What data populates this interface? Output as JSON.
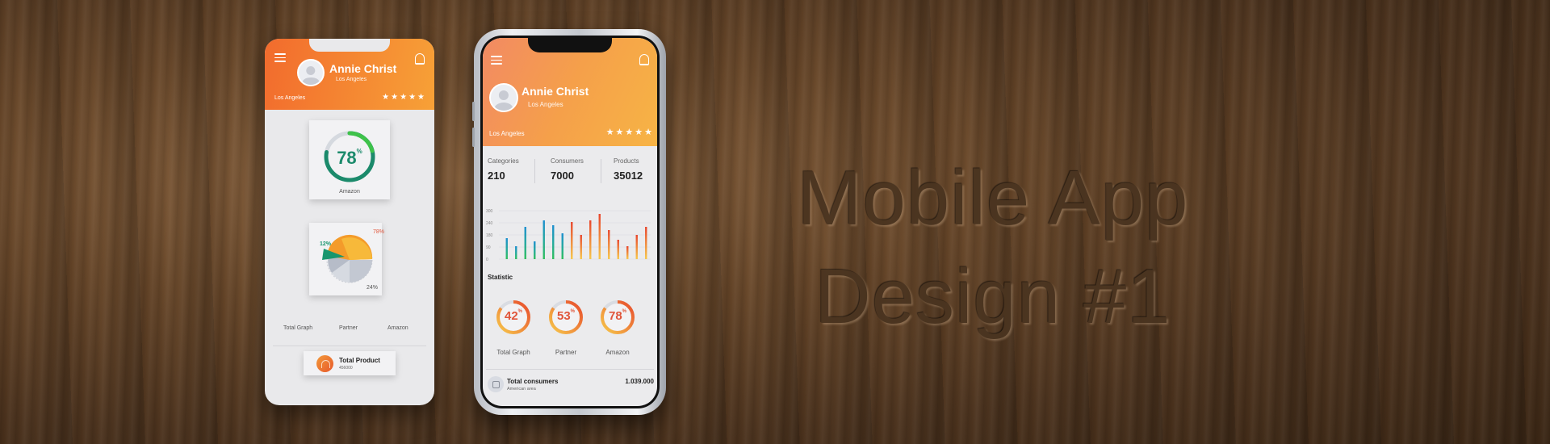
{
  "headline": {
    "line1": "Mobile App",
    "line2": "Design #1"
  },
  "phone1": {
    "user_name": "Annie Christ",
    "city": "Los Angeles",
    "location": "Los Angeles",
    "stars": "★★★★★",
    "gauge_value": "78",
    "gauge_unit": "%",
    "gauge_label": "Amazon",
    "pie_labels": {
      "a": "12%",
      "b": "78%",
      "c": "24%"
    },
    "legend": [
      "Total Graph",
      "Partner",
      "Amazon"
    ],
    "product_title": "Total Product",
    "product_sub": "456000"
  },
  "phone2": {
    "user_name": "Annie Christ",
    "city": "Los Angeles",
    "location": "Los Angeles",
    "stars": "★★★★★",
    "stats": [
      {
        "title": "Categories",
        "value": "210"
      },
      {
        "title": "Consumers",
        "value": "7000"
      },
      {
        "title": "Products",
        "value": "35012"
      }
    ],
    "statistic_label": "Statistic",
    "rings": [
      {
        "value": "42",
        "unit": "%",
        "label": "Total Graph"
      },
      {
        "value": "53",
        "unit": "%",
        "label": "Partner"
      },
      {
        "value": "78",
        "unit": "%",
        "label": "Amazon"
      }
    ],
    "consumers_title": "Total consumers",
    "consumers_sub": "American area",
    "consumers_value": "1.039.000"
  },
  "chart_data": {
    "type": "bar",
    "yticks": [
      "300",
      "240",
      "180",
      "90",
      "0"
    ],
    "ylim": [
      0,
      300
    ],
    "values": [
      130,
      80,
      200,
      110,
      240,
      210,
      160,
      230,
      150,
      240,
      280,
      180,
      120,
      80,
      150,
      200
    ]
  },
  "colors": {
    "accent": "#f7a137",
    "brand_orange": "#f26b2d",
    "green": "#2fb54a",
    "teal": "#1b8a6b"
  }
}
